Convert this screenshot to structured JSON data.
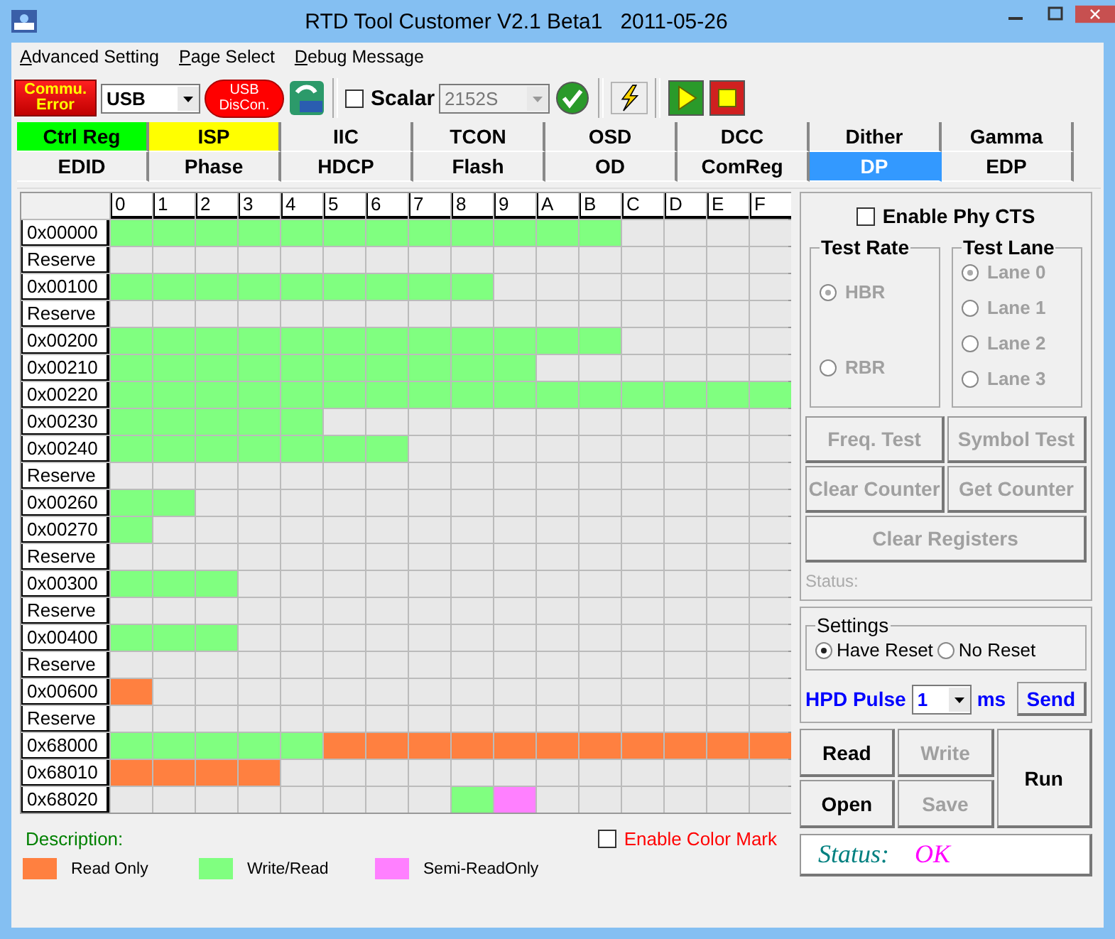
{
  "window": {
    "title": "RTD Tool Customer V2.1 Beta1   2011-05-26"
  },
  "menu": [
    "Advanced Setting",
    "Page Select",
    "Debug Message"
  ],
  "toolbar": {
    "comm_button": "Commu.\nError",
    "interface": "USB",
    "usb_button": "USB\nDisCon.",
    "scalar": {
      "label": "Scalar",
      "checked": false,
      "value": "2152S"
    }
  },
  "tab_rows": [
    [
      {
        "label": "Ctrl Reg",
        "selected": false,
        "color": "#00ff00"
      },
      {
        "label": "ISP",
        "selected": false,
        "color": "#ffff00"
      },
      {
        "label": "IIC",
        "selected": false,
        "color": "#f0f0f0"
      },
      {
        "label": "TCON",
        "selected": false,
        "color": "#f0f0f0"
      },
      {
        "label": "OSD",
        "selected": false,
        "color": "#f0f0f0"
      },
      {
        "label": "DCC",
        "selected": false,
        "color": "#f0f0f0"
      },
      {
        "label": "Dither",
        "selected": false,
        "color": "#f0f0f0"
      },
      {
        "label": "Gamma",
        "selected": false,
        "color": "#f0f0f0"
      }
    ],
    [
      {
        "label": "EDID",
        "selected": false,
        "color": "#f0f0f0"
      },
      {
        "label": "Phase",
        "selected": false,
        "color": "#f0f0f0"
      },
      {
        "label": "HDCP",
        "selected": false,
        "color": "#f0f0f0"
      },
      {
        "label": "Flash",
        "selected": false,
        "color": "#f0f0f0"
      },
      {
        "label": "OD",
        "selected": false,
        "color": "#f0f0f0"
      },
      {
        "label": "ComReg",
        "selected": false,
        "color": "#f0f0f0"
      },
      {
        "label": "DP",
        "selected": true,
        "color": "#3399ff"
      },
      {
        "label": "EDP",
        "selected": false,
        "color": "#f0f0f0"
      }
    ]
  ],
  "grid": {
    "columns": [
      "0",
      "1",
      "2",
      "3",
      "4",
      "5",
      "6",
      "7",
      "8",
      "9",
      "A",
      "B",
      "C",
      "D",
      "E",
      "F"
    ],
    "rows": [
      {
        "label": "0x00000",
        "cells": [
          {
            "kind": "rw"
          },
          {
            "kind": "rw"
          },
          {
            "kind": "rw"
          },
          {
            "kind": "rw"
          },
          {
            "kind": "rw"
          },
          {
            "kind": "rw"
          },
          {
            "kind": "rw"
          },
          {
            "kind": "rw"
          },
          {
            "kind": "rw"
          },
          {
            "kind": "rw"
          },
          {
            "kind": "rw"
          },
          {
            "kind": "rw"
          },
          {
            "kind": "none"
          },
          {
            "kind": "none"
          },
          {
            "kind": "none"
          },
          {
            "kind": "none"
          }
        ]
      },
      {
        "label": "Reserve",
        "cells": [
          {
            "kind": "none"
          },
          {
            "kind": "none"
          },
          {
            "kind": "none"
          },
          {
            "kind": "none"
          },
          {
            "kind": "none"
          },
          {
            "kind": "none"
          },
          {
            "kind": "none"
          },
          {
            "kind": "none"
          },
          {
            "kind": "none"
          },
          {
            "kind": "none"
          },
          {
            "kind": "none"
          },
          {
            "kind": "none"
          },
          {
            "kind": "none"
          },
          {
            "kind": "none"
          },
          {
            "kind": "none"
          },
          {
            "kind": "none"
          }
        ]
      },
      {
        "label": "0x00100",
        "cells": [
          {
            "kind": "rw"
          },
          {
            "kind": "rw"
          },
          {
            "kind": "rw"
          },
          {
            "kind": "rw"
          },
          {
            "kind": "rw"
          },
          {
            "kind": "rw"
          },
          {
            "kind": "rw"
          },
          {
            "kind": "rw"
          },
          {
            "kind": "rw"
          },
          {
            "kind": "none"
          },
          {
            "kind": "none"
          },
          {
            "kind": "none"
          },
          {
            "kind": "none"
          },
          {
            "kind": "none"
          },
          {
            "kind": "none"
          },
          {
            "kind": "none"
          }
        ]
      },
      {
        "label": "Reserve",
        "cells": [
          {
            "kind": "none"
          },
          {
            "kind": "none"
          },
          {
            "kind": "none"
          },
          {
            "kind": "none"
          },
          {
            "kind": "none"
          },
          {
            "kind": "none"
          },
          {
            "kind": "none"
          },
          {
            "kind": "none"
          },
          {
            "kind": "none"
          },
          {
            "kind": "none"
          },
          {
            "kind": "none"
          },
          {
            "kind": "none"
          },
          {
            "kind": "none"
          },
          {
            "kind": "none"
          },
          {
            "kind": "none"
          },
          {
            "kind": "none"
          }
        ]
      },
      {
        "label": "0x00200",
        "cells": [
          {
            "kind": "rw"
          },
          {
            "kind": "rw"
          },
          {
            "kind": "rw"
          },
          {
            "kind": "rw"
          },
          {
            "kind": "rw"
          },
          {
            "kind": "rw"
          },
          {
            "kind": "rw"
          },
          {
            "kind": "rw"
          },
          {
            "kind": "rw"
          },
          {
            "kind": "rw"
          },
          {
            "kind": "rw"
          },
          {
            "kind": "rw"
          },
          {
            "kind": "none"
          },
          {
            "kind": "none"
          },
          {
            "kind": "none"
          },
          {
            "kind": "none"
          }
        ]
      },
      {
        "label": "0x00210",
        "cells": [
          {
            "kind": "rw"
          },
          {
            "kind": "rw"
          },
          {
            "kind": "rw"
          },
          {
            "kind": "rw"
          },
          {
            "kind": "rw"
          },
          {
            "kind": "rw"
          },
          {
            "kind": "rw"
          },
          {
            "kind": "rw"
          },
          {
            "kind": "rw"
          },
          {
            "kind": "rw"
          },
          {
            "kind": "none"
          },
          {
            "kind": "none"
          },
          {
            "kind": "none"
          },
          {
            "kind": "none"
          },
          {
            "kind": "none"
          },
          {
            "kind": "none"
          }
        ]
      },
      {
        "label": "0x00220",
        "cells": [
          {
            "kind": "rw"
          },
          {
            "kind": "rw"
          },
          {
            "kind": "rw"
          },
          {
            "kind": "rw"
          },
          {
            "kind": "rw"
          },
          {
            "kind": "rw"
          },
          {
            "kind": "rw"
          },
          {
            "kind": "rw"
          },
          {
            "kind": "rw"
          },
          {
            "kind": "rw"
          },
          {
            "kind": "rw"
          },
          {
            "kind": "rw"
          },
          {
            "kind": "rw"
          },
          {
            "kind": "rw"
          },
          {
            "kind": "rw"
          },
          {
            "kind": "rw"
          }
        ]
      },
      {
        "label": "0x00230",
        "cells": [
          {
            "kind": "rw"
          },
          {
            "kind": "rw"
          },
          {
            "kind": "rw"
          },
          {
            "kind": "rw"
          },
          {
            "kind": "rw"
          },
          {
            "kind": "none"
          },
          {
            "kind": "none"
          },
          {
            "kind": "none"
          },
          {
            "kind": "none"
          },
          {
            "kind": "none"
          },
          {
            "kind": "none"
          },
          {
            "kind": "none"
          },
          {
            "kind": "none"
          },
          {
            "kind": "none"
          },
          {
            "kind": "none"
          },
          {
            "kind": "none"
          }
        ]
      },
      {
        "label": "0x00240",
        "cells": [
          {
            "kind": "rw"
          },
          {
            "kind": "rw"
          },
          {
            "kind": "rw"
          },
          {
            "kind": "rw"
          },
          {
            "kind": "rw"
          },
          {
            "kind": "rw"
          },
          {
            "kind": "rw"
          },
          {
            "kind": "none"
          },
          {
            "kind": "none"
          },
          {
            "kind": "none"
          },
          {
            "kind": "none"
          },
          {
            "kind": "none"
          },
          {
            "kind": "none"
          },
          {
            "kind": "none"
          },
          {
            "kind": "none"
          },
          {
            "kind": "none"
          }
        ]
      },
      {
        "label": "Reserve",
        "cells": [
          {
            "kind": "none"
          },
          {
            "kind": "none"
          },
          {
            "kind": "none"
          },
          {
            "kind": "none"
          },
          {
            "kind": "none"
          },
          {
            "kind": "none"
          },
          {
            "kind": "none"
          },
          {
            "kind": "none"
          },
          {
            "kind": "none"
          },
          {
            "kind": "none"
          },
          {
            "kind": "none"
          },
          {
            "kind": "none"
          },
          {
            "kind": "none"
          },
          {
            "kind": "none"
          },
          {
            "kind": "none"
          },
          {
            "kind": "none"
          }
        ]
      },
      {
        "label": "0x00260",
        "cells": [
          {
            "kind": "rw"
          },
          {
            "kind": "rw"
          },
          {
            "kind": "none"
          },
          {
            "kind": "none"
          },
          {
            "kind": "none"
          },
          {
            "kind": "none"
          },
          {
            "kind": "none"
          },
          {
            "kind": "none"
          },
          {
            "kind": "none"
          },
          {
            "kind": "none"
          },
          {
            "kind": "none"
          },
          {
            "kind": "none"
          },
          {
            "kind": "none"
          },
          {
            "kind": "none"
          },
          {
            "kind": "none"
          },
          {
            "kind": "none"
          }
        ]
      },
      {
        "label": "0x00270",
        "cells": [
          {
            "kind": "rw"
          },
          {
            "kind": "none"
          },
          {
            "kind": "none"
          },
          {
            "kind": "none"
          },
          {
            "kind": "none"
          },
          {
            "kind": "none"
          },
          {
            "kind": "none"
          },
          {
            "kind": "none"
          },
          {
            "kind": "none"
          },
          {
            "kind": "none"
          },
          {
            "kind": "none"
          },
          {
            "kind": "none"
          },
          {
            "kind": "none"
          },
          {
            "kind": "none"
          },
          {
            "kind": "none"
          },
          {
            "kind": "none"
          }
        ]
      },
      {
        "label": "Reserve",
        "cells": [
          {
            "kind": "none"
          },
          {
            "kind": "none"
          },
          {
            "kind": "none"
          },
          {
            "kind": "none"
          },
          {
            "kind": "none"
          },
          {
            "kind": "none"
          },
          {
            "kind": "none"
          },
          {
            "kind": "none"
          },
          {
            "kind": "none"
          },
          {
            "kind": "none"
          },
          {
            "kind": "none"
          },
          {
            "kind": "none"
          },
          {
            "kind": "none"
          },
          {
            "kind": "none"
          },
          {
            "kind": "none"
          },
          {
            "kind": "none"
          }
        ]
      },
      {
        "label": "0x00300",
        "cells": [
          {
            "kind": "rw"
          },
          {
            "kind": "rw"
          },
          {
            "kind": "rw"
          },
          {
            "kind": "none"
          },
          {
            "kind": "none"
          },
          {
            "kind": "none"
          },
          {
            "kind": "none"
          },
          {
            "kind": "none"
          },
          {
            "kind": "none"
          },
          {
            "kind": "none"
          },
          {
            "kind": "none"
          },
          {
            "kind": "none"
          },
          {
            "kind": "none"
          },
          {
            "kind": "none"
          },
          {
            "kind": "none"
          },
          {
            "kind": "none"
          }
        ]
      },
      {
        "label": "Reserve",
        "cells": [
          {
            "kind": "none"
          },
          {
            "kind": "none"
          },
          {
            "kind": "none"
          },
          {
            "kind": "none"
          },
          {
            "kind": "none"
          },
          {
            "kind": "none"
          },
          {
            "kind": "none"
          },
          {
            "kind": "none"
          },
          {
            "kind": "none"
          },
          {
            "kind": "none"
          },
          {
            "kind": "none"
          },
          {
            "kind": "none"
          },
          {
            "kind": "none"
          },
          {
            "kind": "none"
          },
          {
            "kind": "none"
          },
          {
            "kind": "none"
          }
        ]
      },
      {
        "label": "0x00400",
        "cells": [
          {
            "kind": "rw"
          },
          {
            "kind": "rw"
          },
          {
            "kind": "rw"
          },
          {
            "kind": "none"
          },
          {
            "kind": "none"
          },
          {
            "kind": "none"
          },
          {
            "kind": "none"
          },
          {
            "kind": "none"
          },
          {
            "kind": "none"
          },
          {
            "kind": "none"
          },
          {
            "kind": "none"
          },
          {
            "kind": "none"
          },
          {
            "kind": "none"
          },
          {
            "kind": "none"
          },
          {
            "kind": "none"
          },
          {
            "kind": "none"
          }
        ]
      },
      {
        "label": "Reserve",
        "cells": [
          {
            "kind": "none"
          },
          {
            "kind": "none"
          },
          {
            "kind": "none"
          },
          {
            "kind": "none"
          },
          {
            "kind": "none"
          },
          {
            "kind": "none"
          },
          {
            "kind": "none"
          },
          {
            "kind": "none"
          },
          {
            "kind": "none"
          },
          {
            "kind": "none"
          },
          {
            "kind": "none"
          },
          {
            "kind": "none"
          },
          {
            "kind": "none"
          },
          {
            "kind": "none"
          },
          {
            "kind": "none"
          },
          {
            "kind": "none"
          }
        ]
      },
      {
        "label": "0x00600",
        "cells": [
          {
            "kind": "ro"
          },
          {
            "kind": "none"
          },
          {
            "kind": "none"
          },
          {
            "kind": "none"
          },
          {
            "kind": "none"
          },
          {
            "kind": "none"
          },
          {
            "kind": "none"
          },
          {
            "kind": "none"
          },
          {
            "kind": "none"
          },
          {
            "kind": "none"
          },
          {
            "kind": "none"
          },
          {
            "kind": "none"
          },
          {
            "kind": "none"
          },
          {
            "kind": "none"
          },
          {
            "kind": "none"
          },
          {
            "kind": "none"
          }
        ]
      },
      {
        "label": "Reserve",
        "cells": [
          {
            "kind": "none"
          },
          {
            "kind": "none"
          },
          {
            "kind": "none"
          },
          {
            "kind": "none"
          },
          {
            "kind": "none"
          },
          {
            "kind": "none"
          },
          {
            "kind": "none"
          },
          {
            "kind": "none"
          },
          {
            "kind": "none"
          },
          {
            "kind": "none"
          },
          {
            "kind": "none"
          },
          {
            "kind": "none"
          },
          {
            "kind": "none"
          },
          {
            "kind": "none"
          },
          {
            "kind": "none"
          },
          {
            "kind": "none"
          }
        ]
      },
      {
        "label": "0x68000",
        "cells": [
          {
            "kind": "rw"
          },
          {
            "kind": "rw"
          },
          {
            "kind": "rw"
          },
          {
            "kind": "rw"
          },
          {
            "kind": "rw"
          },
          {
            "kind": "ro"
          },
          {
            "kind": "ro"
          },
          {
            "kind": "ro"
          },
          {
            "kind": "ro"
          },
          {
            "kind": "ro"
          },
          {
            "kind": "ro"
          },
          {
            "kind": "ro"
          },
          {
            "kind": "ro"
          },
          {
            "kind": "ro"
          },
          {
            "kind": "ro"
          },
          {
            "kind": "ro"
          }
        ]
      },
      {
        "label": "0x68010",
        "cells": [
          {
            "kind": "ro"
          },
          {
            "kind": "ro"
          },
          {
            "kind": "ro"
          },
          {
            "kind": "ro"
          },
          {
            "kind": "none"
          },
          {
            "kind": "none"
          },
          {
            "kind": "none"
          },
          {
            "kind": "none"
          },
          {
            "kind": "none"
          },
          {
            "kind": "none"
          },
          {
            "kind": "none"
          },
          {
            "kind": "none"
          },
          {
            "kind": "none"
          },
          {
            "kind": "none"
          },
          {
            "kind": "none"
          },
          {
            "kind": "none"
          }
        ]
      },
      {
        "label": "0x68020",
        "cells": [
          {
            "kind": "none"
          },
          {
            "kind": "none"
          },
          {
            "kind": "none"
          },
          {
            "kind": "none"
          },
          {
            "kind": "none"
          },
          {
            "kind": "none"
          },
          {
            "kind": "none"
          },
          {
            "kind": "none"
          },
          {
            "kind": "rw"
          },
          {
            "kind": "semi"
          },
          {
            "kind": "none"
          },
          {
            "kind": "none"
          },
          {
            "kind": "none"
          },
          {
            "kind": "none"
          },
          {
            "kind": "none"
          },
          {
            "kind": "none"
          }
        ]
      }
    ]
  },
  "legend": {
    "title": "Description:",
    "items": [
      {
        "kind": "ro",
        "label": "Read Only",
        "color": "#ff8040"
      },
      {
        "kind": "rw",
        "label": "Write/Read",
        "color": "#80ff80"
      },
      {
        "kind": "semi",
        "label": "Semi-ReadOnly",
        "color": "#ff80ff"
      }
    ],
    "color_mark": {
      "label": "Enable Color Mark",
      "checked": false
    }
  },
  "dp": {
    "enable_phy_cts": {
      "label": "Enable Phy CTS",
      "checked": false
    },
    "test_rate": {
      "title": "Test Rate",
      "disabled": true,
      "options": [
        {
          "label": "HBR",
          "selected": true
        },
        {
          "label": "RBR",
          "selected": false
        }
      ]
    },
    "test_lane": {
      "title": "Test Lane",
      "disabled": true,
      "options": [
        {
          "label": "Lane 0",
          "selected": true
        },
        {
          "label": "Lane 1",
          "selected": false
        },
        {
          "label": "Lane 2",
          "selected": false
        },
        {
          "label": "Lane 3",
          "selected": false
        }
      ]
    },
    "buttons": [
      {
        "label": "Freq. Test",
        "disabled": true
      },
      {
        "label": "Symbol Test",
        "disabled": true
      },
      {
        "label": "Clear Counter",
        "disabled": true
      },
      {
        "label": "Get Counter",
        "disabled": true
      },
      {
        "label": "Clear Registers",
        "disabled": true
      }
    ],
    "status": "Status:"
  },
  "settings": {
    "title": "Settings",
    "options": [
      {
        "label": "Have Reset",
        "selected": true
      },
      {
        "label": "No Reset",
        "selected": false
      }
    ],
    "hpd": {
      "label": "HPD Pulse",
      "value": "1",
      "unit": "ms",
      "send": "Send"
    }
  },
  "actions": [
    {
      "label": "Read",
      "disabled": false,
      "kind": "normal"
    },
    {
      "label": "Write",
      "disabled": true,
      "kind": "normal"
    },
    {
      "label": "Run",
      "disabled": false,
      "kind": "tall"
    },
    {
      "label": "Open",
      "disabled": false,
      "kind": "normal"
    },
    {
      "label": "Save",
      "disabled": true,
      "kind": "normal"
    }
  ],
  "status": {
    "label": "Status:",
    "value": "OK"
  }
}
